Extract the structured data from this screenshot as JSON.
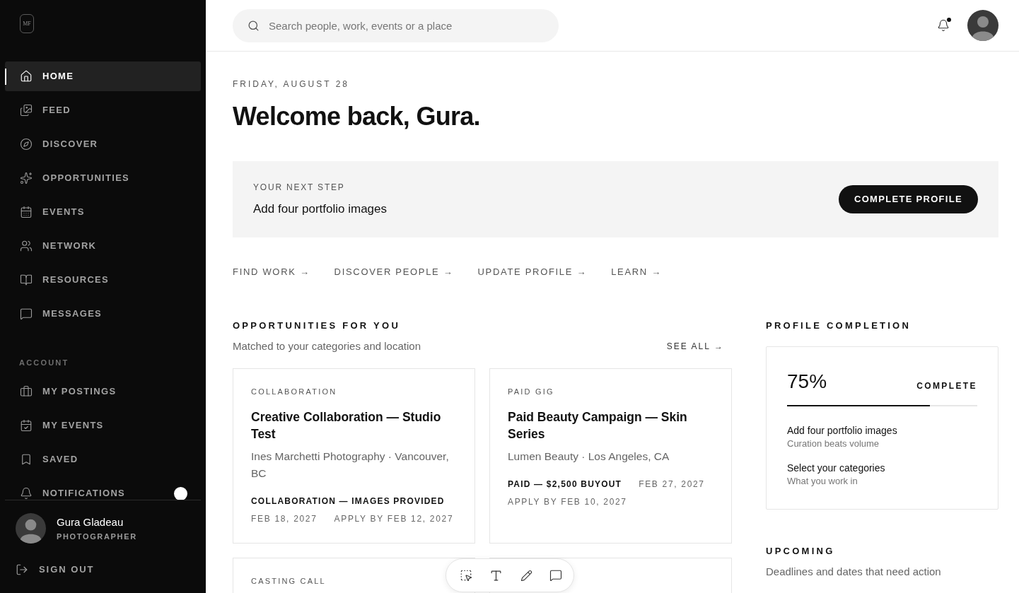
{
  "sidebar": {
    "logo": "MF",
    "nav": [
      {
        "label": "HOME",
        "selected": true
      },
      {
        "label": "FEED",
        "selected": false
      },
      {
        "label": "DISCOVER",
        "selected": false
      },
      {
        "label": "OPPORTUNITIES",
        "selected": false
      },
      {
        "label": "EVENTS",
        "selected": false
      },
      {
        "label": "NETWORK",
        "selected": false
      },
      {
        "label": "RESOURCES",
        "selected": false
      },
      {
        "label": "MESSAGES",
        "selected": false
      }
    ],
    "account": {
      "heading": "ACCOUNT",
      "items": [
        {
          "label": "MY POSTINGS",
          "selected": false,
          "badge": false
        },
        {
          "label": "MY EVENTS",
          "selected": false,
          "badge": false
        },
        {
          "label": "SAVED",
          "selected": false,
          "badge": false
        },
        {
          "label": "NOTIFICATIONS",
          "selected": false,
          "badge": true
        }
      ]
    },
    "user": {
      "name": "Gura Gladeau",
      "role": "PHOTOGRAPHER"
    },
    "sign_out": "SIGN OUT"
  },
  "topbar": {
    "search": {
      "placeholder": "Search people, work, events or a place"
    },
    "unread_notifications": true
  },
  "header": {
    "date": "FRIDAY, AUGUST 28",
    "title": "Welcome back, Gura."
  },
  "next_step": {
    "label": "YOUR NEXT STEP",
    "text": "Add four portfolio images",
    "button": "COMPLETE PROFILE"
  },
  "quick_links": [
    "FIND WORK →",
    "DISCOVER PEOPLE →",
    "UPDATE PROFILE →",
    "LEARN →"
  ],
  "opportunities": {
    "title": "OPPORTUNITIES FOR YOU",
    "subtitle": "Matched to your categories and location",
    "see_all": "SEE ALL →",
    "cards": [
      {
        "kind": "opportunity",
        "category": "COLLABORATION",
        "title": "Creative Collaboration — Studio Test",
        "subtitle": "Ines Marchetti Photography · Vancouver, BC",
        "meta": [
          {
            "kind": "terms",
            "text": "COLLABORATION — IMAGES PROVIDED"
          },
          {
            "kind": "date",
            "text": "FEB 18, 2027"
          },
          {
            "kind": "date",
            "text": "APPLY BY FEB 12, 2027"
          }
        ]
      },
      {
        "kind": "opportunity",
        "category": "PAID GIG",
        "title": "Paid Beauty Campaign — Skin Series",
        "subtitle": "Lumen Beauty · Los Angeles, CA",
        "meta": [
          {
            "kind": "terms",
            "text": "PAID — $2,500 BUYOUT"
          },
          {
            "kind": "date",
            "text": "FEB 27, 2027"
          },
          {
            "kind": "date",
            "text": "APPLY BY FEB 10, 2027"
          }
        ]
      },
      {
        "kind": "opportunity",
        "category": "CASTING CALL"
      },
      {
        "kind": "opportunity"
      }
    ]
  },
  "profile_completion": {
    "title": "PROFILE COMPLETION",
    "percent": "75%",
    "label": "COMPLETE",
    "level": 0.75,
    "tasks": [
      {
        "title": "Add four portfolio images",
        "hint": "Curation beats volume"
      },
      {
        "title": "Select your categories",
        "hint": "What you work in"
      }
    ]
  },
  "upcoming": {
    "title": "UPCOMING",
    "subtitle": "Deadlines and dates that need action"
  }
}
